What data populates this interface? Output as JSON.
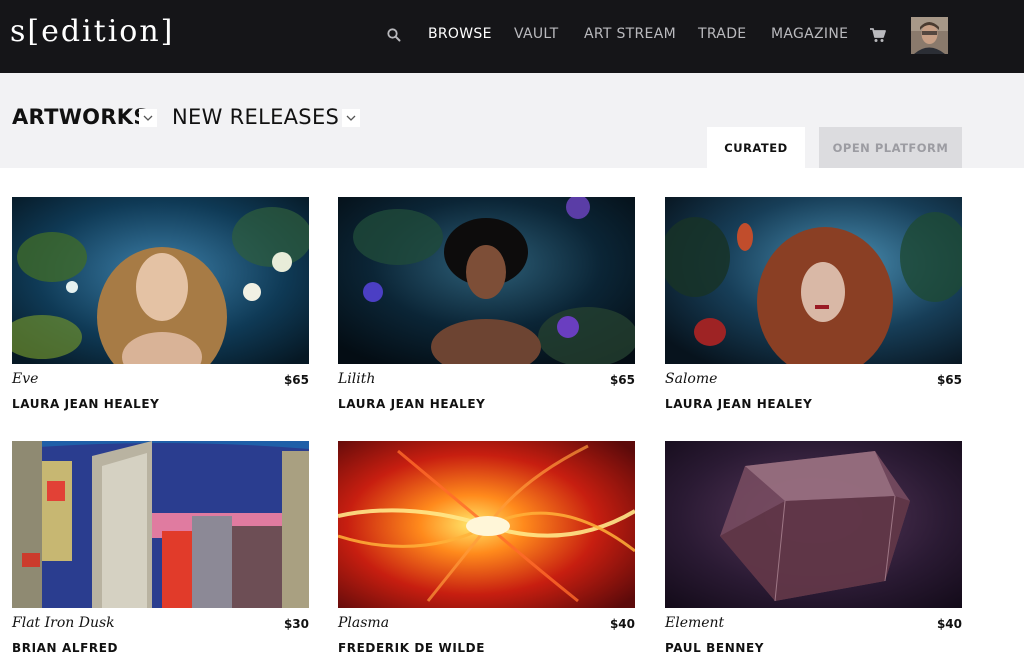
{
  "logo": {
    "text": "s[edition]"
  },
  "nav": {
    "search_icon": "search-icon",
    "links": [
      {
        "label": "BROWSE",
        "active": true
      },
      {
        "label": "VAULT",
        "active": false
      },
      {
        "label": "ART STREAM",
        "active": false
      },
      {
        "label": "TRADE",
        "active": false
      },
      {
        "label": "MAGAZINE",
        "active": false
      }
    ],
    "cart_icon": "cart-icon",
    "avatar_icon": "user-avatar"
  },
  "subheader": {
    "section": "ARTWORKS",
    "filter": "NEW RELEASES",
    "dropdown_icon": "chevron-down-icon",
    "tabs": [
      {
        "label": "CURATED",
        "selected": true
      },
      {
        "label": "OPEN PLATFORM",
        "selected": false
      }
    ]
  },
  "artworks": [
    {
      "title": "Eve",
      "price": "$65",
      "artist": "LAURA JEAN HEALEY"
    },
    {
      "title": "Lilith",
      "price": "$65",
      "artist": "LAURA JEAN HEALEY"
    },
    {
      "title": "Salome",
      "price": "$65",
      "artist": "LAURA JEAN HEALEY"
    },
    {
      "title": "Flat Iron Dusk",
      "price": "$30",
      "artist": "BRIAN ALFRED"
    },
    {
      "title": "Plasma",
      "price": "$40",
      "artist": "FREDERIK DE WILDE"
    },
    {
      "title": "Element",
      "price": "$40",
      "artist": "PAUL BENNEY"
    }
  ],
  "colors": {
    "nav_bg": "#151518",
    "subheader_bg": "#f2f2f4",
    "tab_inactive_bg": "#dcdcdf"
  }
}
